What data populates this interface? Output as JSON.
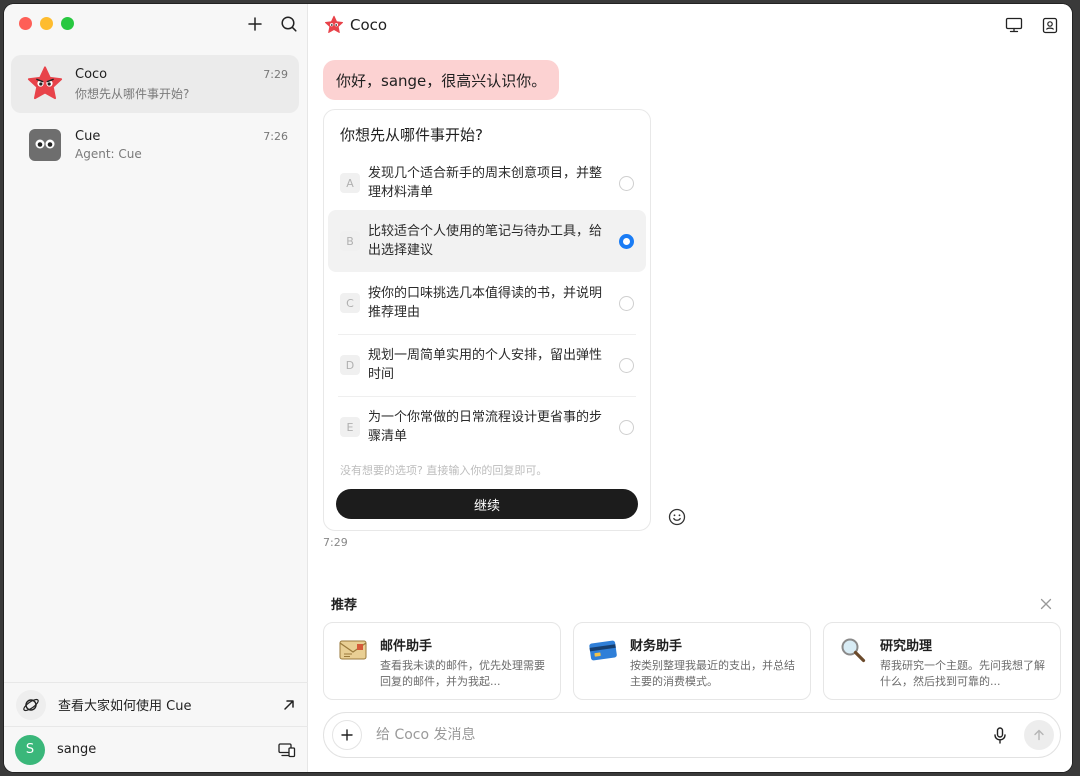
{
  "sidebar": {
    "chats": [
      {
        "name": "Coco",
        "time": "7:29",
        "preview": "你想先从哪件事开始?"
      },
      {
        "name": "Cue",
        "time": "7:26",
        "preview": "Agent: Cue"
      }
    ],
    "explore_label": "查看大家如何使用 Cue",
    "user": {
      "initial": "S",
      "name": "sange",
      "avatar_color": "#3ab77a"
    }
  },
  "header": {
    "title": "Coco"
  },
  "conversation": {
    "greeting": "你好，sange，很高兴认识你。",
    "question_card": {
      "title": "你想先从哪件事开始?",
      "options": [
        {
          "letter": "A",
          "text": "发现几个适合新手的周末创意项目，并整理材料清单",
          "selected": false
        },
        {
          "letter": "B",
          "text": "比较适合个人使用的笔记与待办工具，给出选择建议",
          "selected": true
        },
        {
          "letter": "C",
          "text": "按你的口味挑选几本值得读的书，并说明推荐理由",
          "selected": false
        },
        {
          "letter": "D",
          "text": "规划一周简单实用的个人安排，留出弹性时间",
          "selected": false
        },
        {
          "letter": "E",
          "text": "为一个你常做的日常流程设计更省事的步骤清单",
          "selected": false
        }
      ],
      "hint": "没有想要的选项? 直接输入你的回复即可。",
      "continue_label": "继续"
    },
    "time": "7:29"
  },
  "recommend": {
    "title": "推荐",
    "cards": [
      {
        "name": "邮件助手",
        "desc": "查看我未读的邮件，优先处理需要回复的邮件，并为我起...",
        "icon": "mail-icon"
      },
      {
        "name": "财务助手",
        "desc": "按类别整理我最近的支出，并总结主要的消费模式。",
        "icon": "credit-card-icon"
      },
      {
        "name": "研究助理",
        "desc": "帮我研究一个主题。先问我想了解什么，然后找到可靠的...",
        "icon": "magnifier-icon"
      }
    ]
  },
  "composer": {
    "placeholder": "给 Coco 发消息"
  },
  "colors": {
    "accent": "#1a7cf5",
    "greeting_bubble": "#fcd2d2",
    "coco_red": "#e8434a"
  }
}
